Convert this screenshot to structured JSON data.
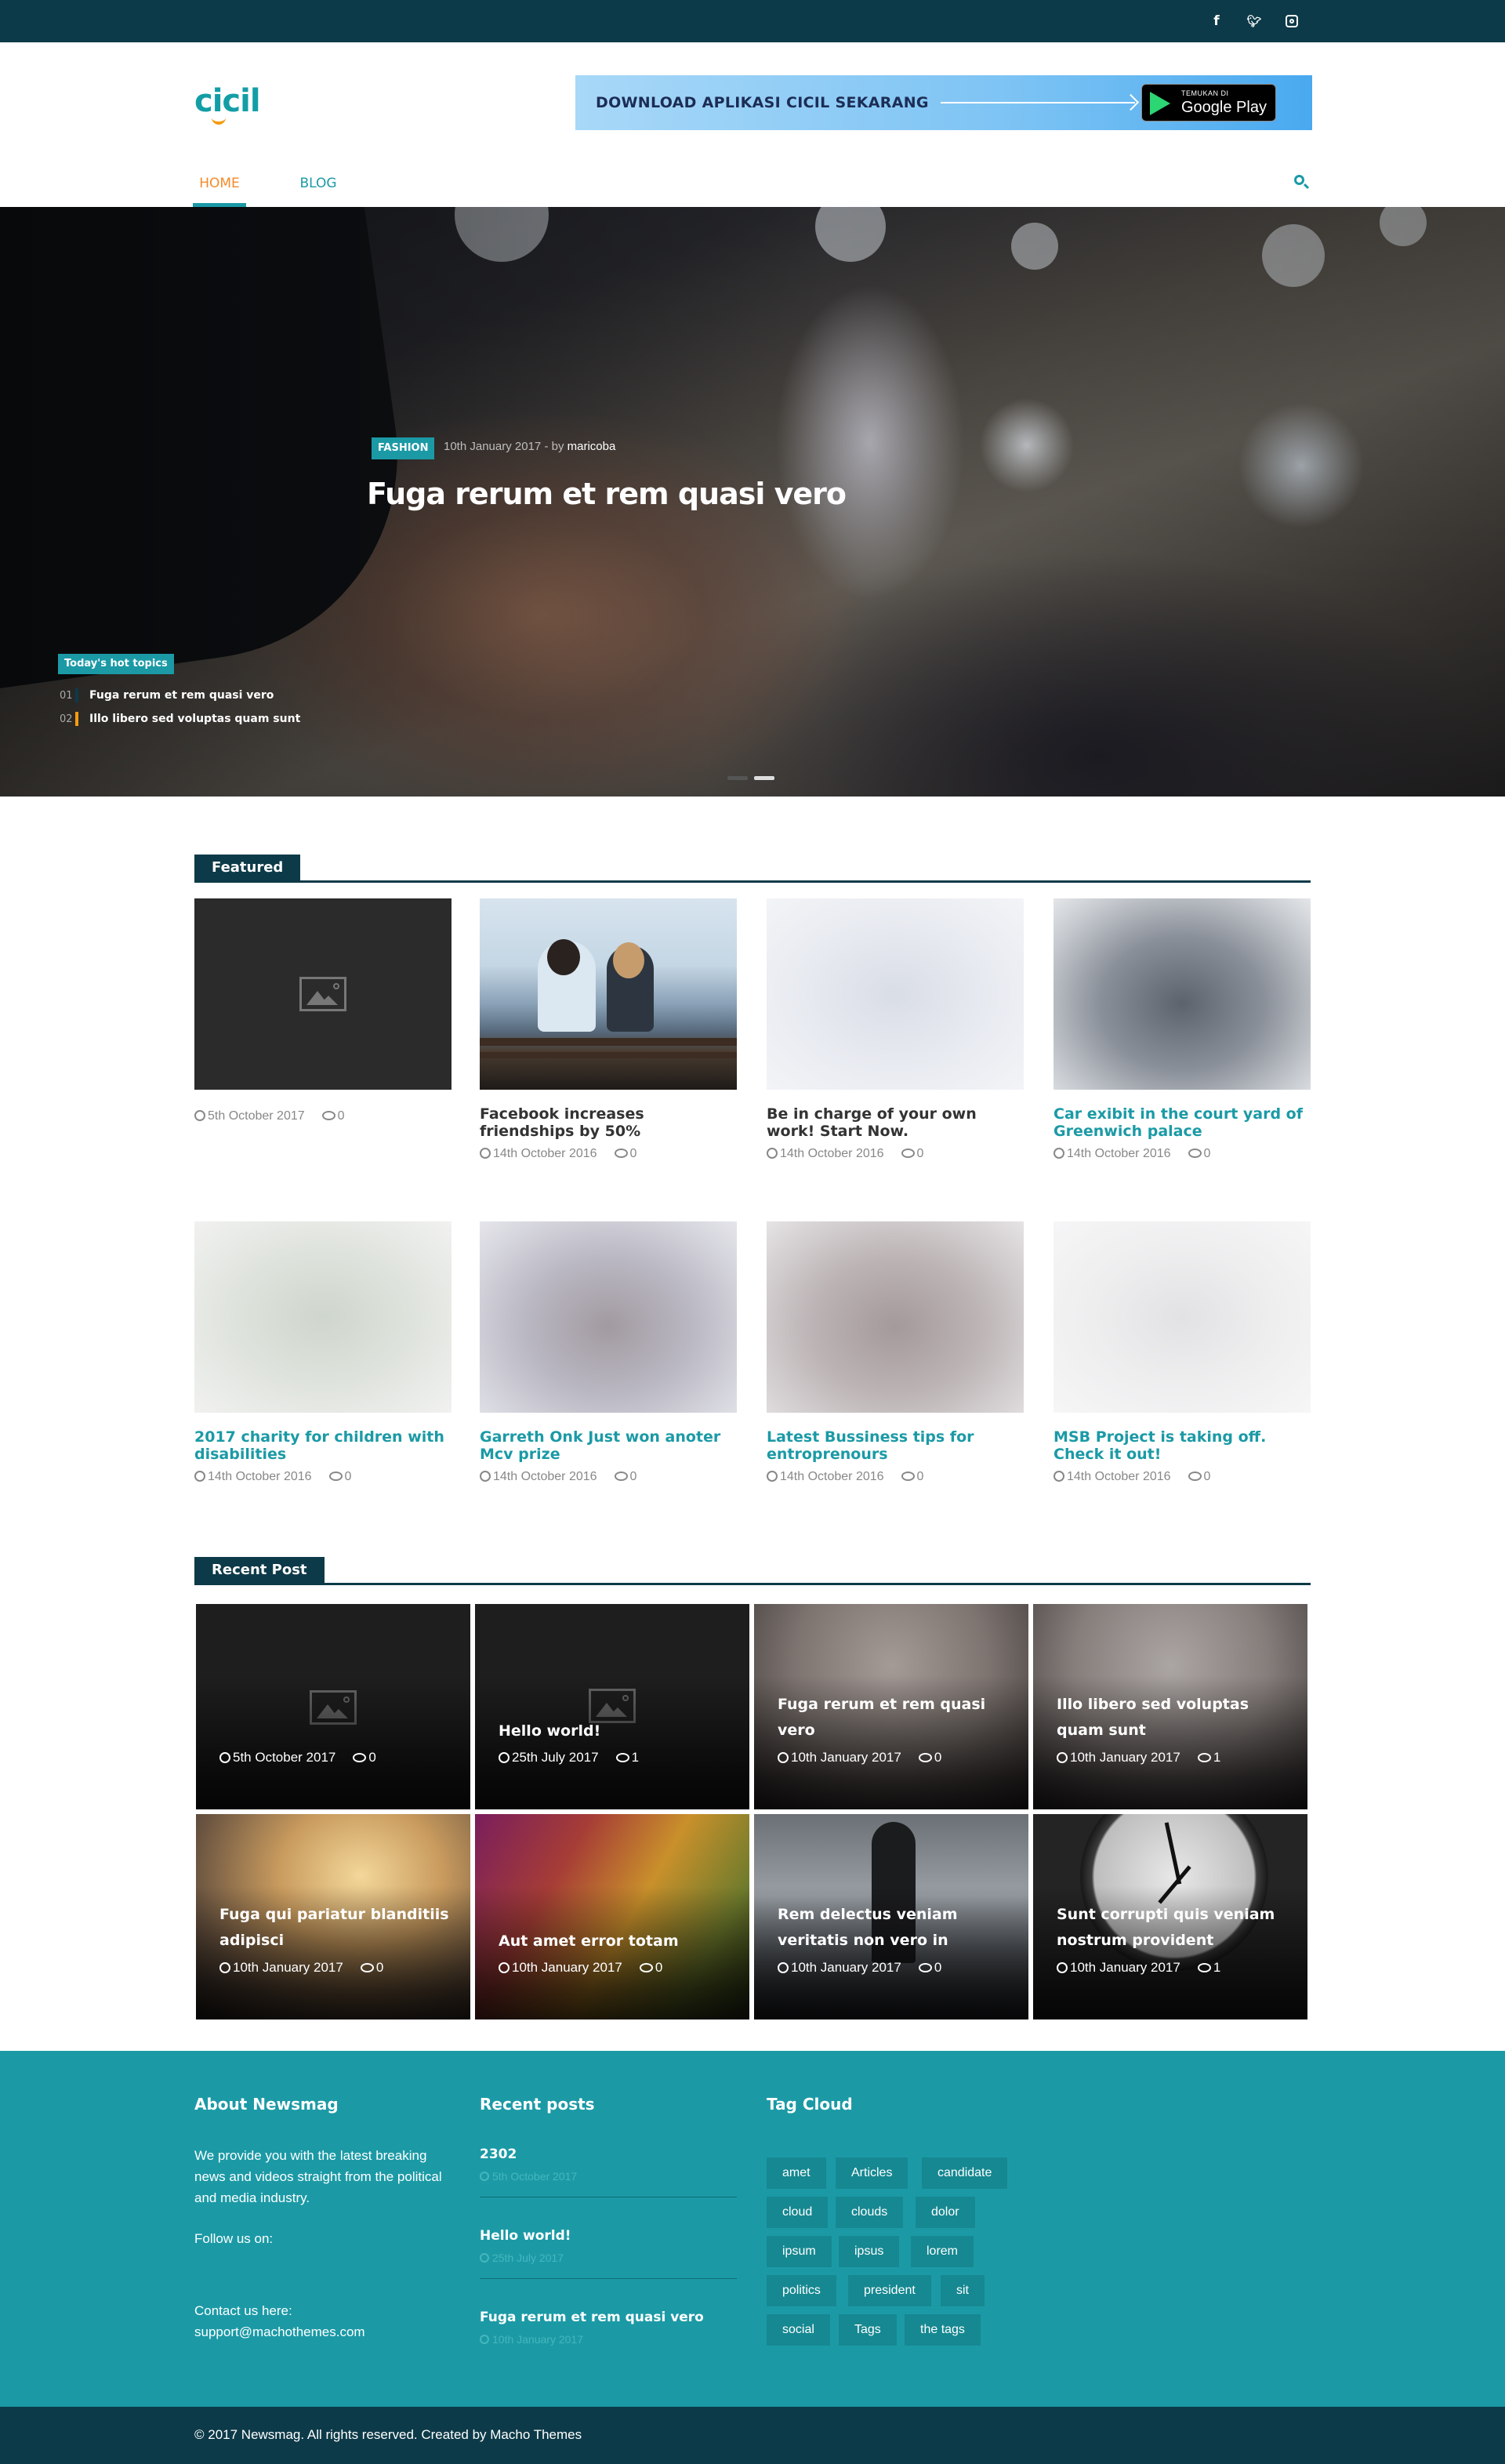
{
  "social": {
    "items": [
      {
        "name": "facebook-icon",
        "glyph": "f"
      },
      {
        "name": "twitter-icon",
        "glyph": "❧"
      },
      {
        "name": "instagram-icon",
        "glyph": "◎"
      }
    ]
  },
  "header": {
    "logo": "cicil",
    "banner_text": "DOWNLOAD APLIKASI CICIL SEKARANG",
    "gplay_small": "TEMUKAN DI",
    "gplay_big": "Google Play"
  },
  "nav": {
    "home": "HOME",
    "blog": "BLOG"
  },
  "hero": {
    "category": "FASHION",
    "date": "10th January 2017",
    "by": "by",
    "author": "maricoba",
    "title": "Fuga rerum et rem quasi vero",
    "hot_label": "Today's hot topics",
    "hot_items": [
      {
        "num": "01",
        "title": "Fuga rerum et rem quasi vero"
      },
      {
        "num": "02",
        "title": "Illo libero sed voluptas quam sunt"
      }
    ]
  },
  "featured": {
    "heading": "Featured",
    "cards": [
      {
        "title": "",
        "date": "5th October 2017",
        "comments": "0"
      },
      {
        "title": "Facebook increases friendships by 50%",
        "date": "14th October 2016",
        "comments": "0"
      },
      {
        "title": "Be in charge of your own work! Start Now.",
        "date": "14th October 2016",
        "comments": "0"
      },
      {
        "title": "Car exibit in the court yard of Greenwich palace",
        "date": "14th October 2016",
        "comments": "0"
      },
      {
        "title": "2017 charity for children with disabilities",
        "date": "14th October 2016",
        "comments": "0"
      },
      {
        "title": "Garreth Onk Just won anoter Mcv prize",
        "date": "14th October 2016",
        "comments": "0"
      },
      {
        "title": "Latest Bussiness tips for entroprenours",
        "date": "14th October 2016",
        "comments": "0"
      },
      {
        "title": "MSB Project is taking off. Check it out!",
        "date": "14th October 2016",
        "comments": "0"
      }
    ]
  },
  "recent": {
    "heading": "Recent Post",
    "tiles": [
      {
        "title": "",
        "date": "5th October 2017",
        "comments": "0"
      },
      {
        "title": "Hello world!",
        "date": "25th July 2017",
        "comments": "1"
      },
      {
        "title": "Fuga rerum et rem quasi vero",
        "date": "10th January 2017",
        "comments": "0"
      },
      {
        "title": "Illo libero sed voluptas quam sunt",
        "date": "10th January 2017",
        "comments": "1"
      },
      {
        "title": "Fuga qui pariatur blanditiis adipisci",
        "date": "10th January 2017",
        "comments": "0"
      },
      {
        "title": "Aut amet error totam",
        "date": "10th January 2017",
        "comments": "0"
      },
      {
        "title": "Rem delectus veniam veritatis non vero in",
        "date": "10th January 2017",
        "comments": "0"
      },
      {
        "title": "Sunt corrupti quis veniam nostrum provident",
        "date": "10th January 2017",
        "comments": "1"
      }
    ]
  },
  "footer": {
    "about_heading": "About Newsmag",
    "about_text": "We provide you with the latest breaking news and videos straight from the political and media industry.",
    "follow": "Follow us on:",
    "contact_label": "Contact us here:",
    "contact_email": "support@machothemes.com",
    "recent_heading": "Recent posts",
    "recent_posts": [
      {
        "title": "2302",
        "date": "5th October 2017"
      },
      {
        "title": "Hello world!",
        "date": "25th July 2017"
      },
      {
        "title": "Fuga rerum et rem quasi vero",
        "date": "10th January 2017"
      }
    ],
    "tag_heading": "Tag Cloud",
    "tags": [
      "amet",
      "Articles",
      "candidate",
      "cloud",
      "clouds",
      "dolor",
      "ipsum",
      "ipsus",
      "lorem",
      "politics",
      "president",
      "sit",
      "social",
      "Tags",
      "the tags"
    ],
    "copyright": "© 2017 Newsmag. All rights reserved. Created by Macho Themes"
  },
  "colors": {
    "accent": "#1b9aa6",
    "dark": "#0d3a48",
    "nav_active": "#f38b2a"
  }
}
